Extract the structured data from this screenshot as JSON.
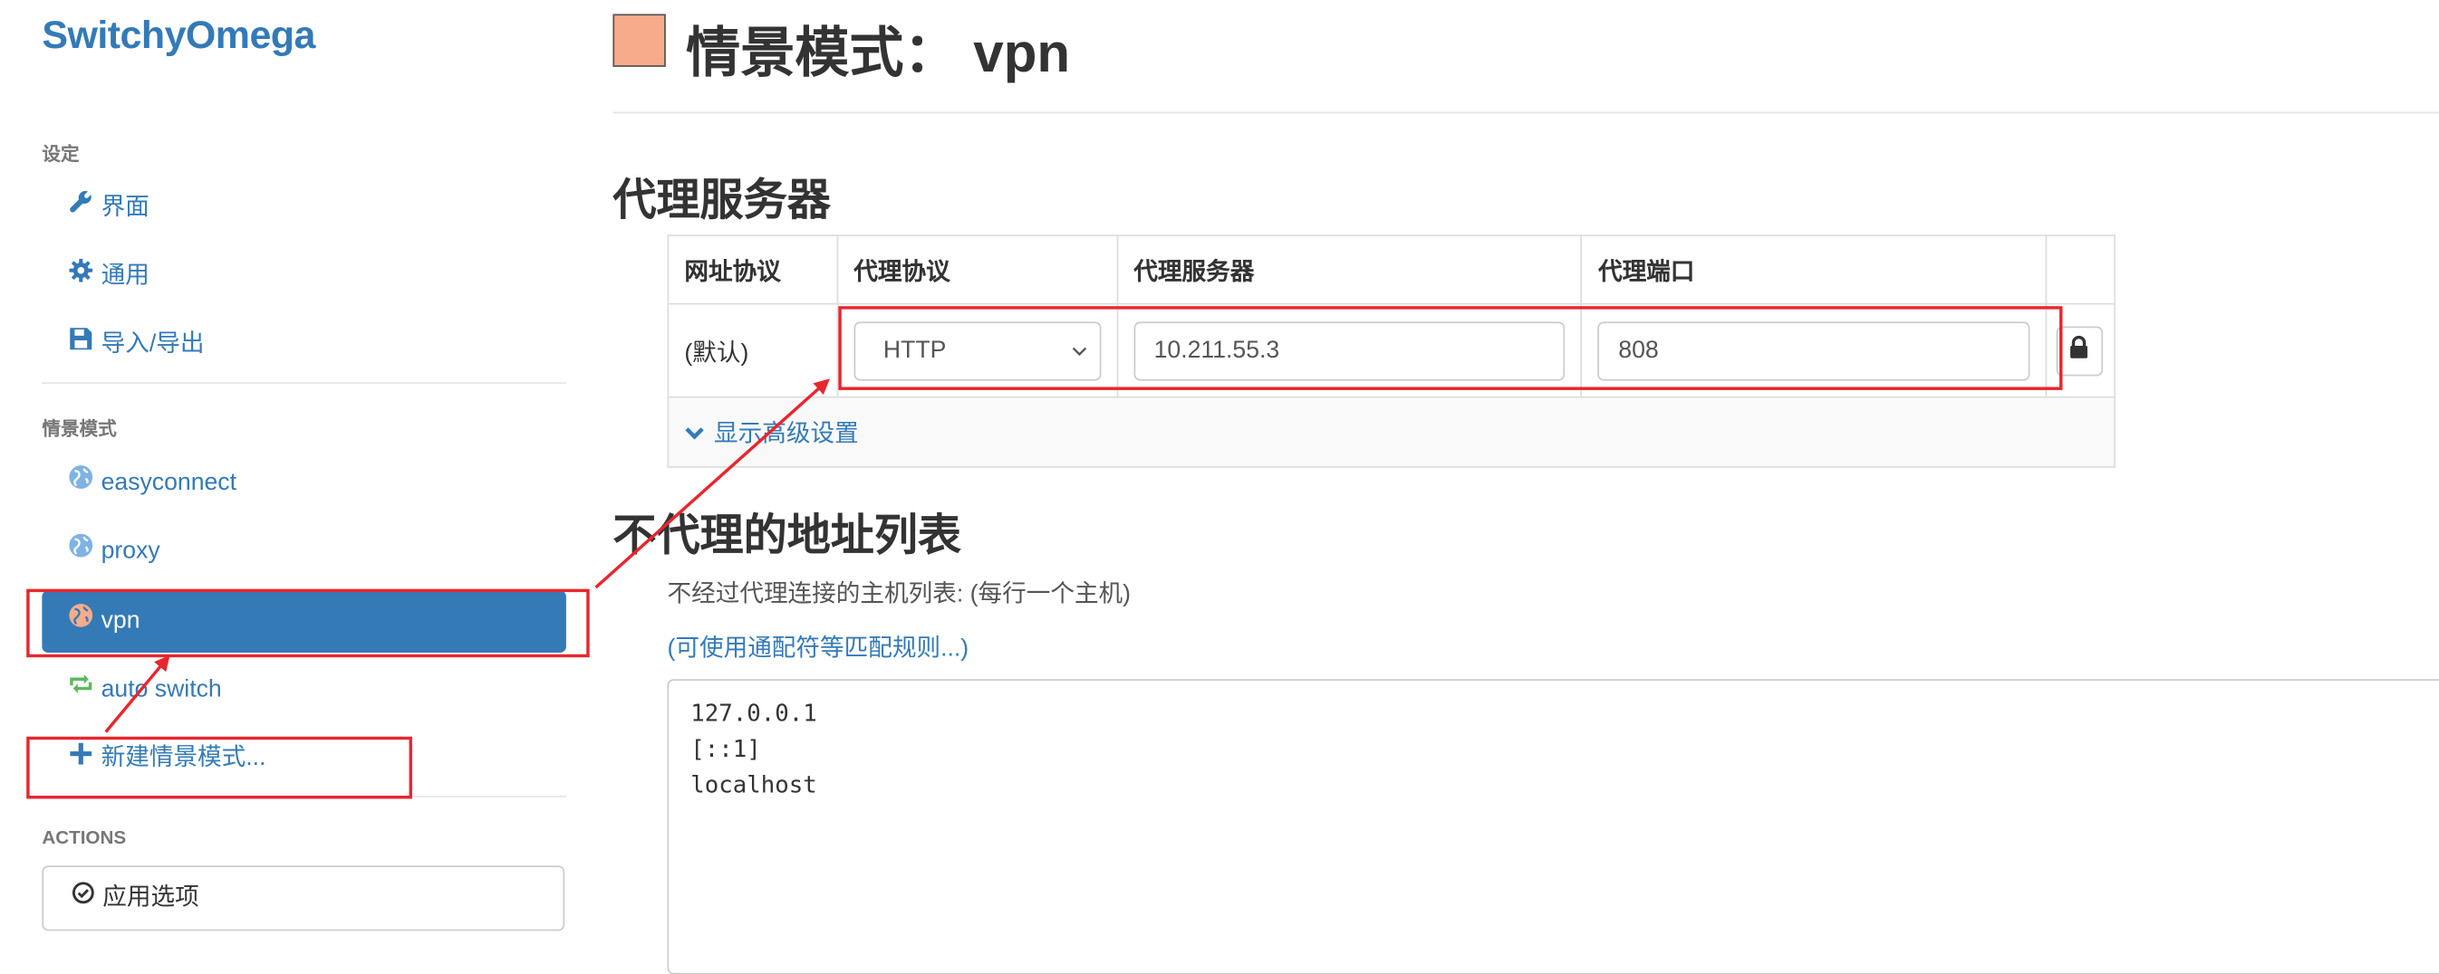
{
  "app": {
    "name": "SwitchyOmega"
  },
  "sidebar": {
    "settings_header": "设定",
    "settings_items": [
      {
        "label": "界面",
        "icon": "wrench-icon"
      },
      {
        "label": "通用",
        "icon": "gear-icon"
      },
      {
        "label": "导入/导出",
        "icon": "floppy-disk-icon"
      }
    ],
    "profiles_header": "情景模式",
    "profiles": [
      {
        "label": "easyconnect",
        "icon": "globe-icon",
        "color": "#5b9bd5"
      },
      {
        "label": "proxy",
        "icon": "globe-icon",
        "color": "#5b9bd5"
      },
      {
        "label": "vpn",
        "icon": "globe-icon",
        "color": "#f8ab8a",
        "active": true
      },
      {
        "label": "auto switch",
        "icon": "switch-icon",
        "color": "#5cb85c"
      }
    ],
    "new_profile": "新建情景模式...",
    "actions_header": "ACTIONS",
    "apply_label": "应用选项"
  },
  "main": {
    "title_prefix": "情景模式：",
    "profile_name": "vpn",
    "profile_color": "#f8ab8a",
    "proxy_section_title": "代理服务器",
    "table": {
      "headers": [
        "网址协议",
        "代理协议",
        "代理服务器",
        "代理端口"
      ],
      "row_label": "(默认)",
      "protocol": "HTTP",
      "server": "10.211.55.3",
      "port": "808",
      "advanced_label": "显示高级设置"
    },
    "bypass_section_title": "不代理的地址列表",
    "bypass_help": "不经过代理连接的主机列表: (每行一个主机)",
    "bypass_link": "(可使用通配符等匹配规则...)",
    "bypass_list": [
      "127.0.0.1",
      "[::1]",
      "localhost"
    ]
  },
  "colors": {
    "accent": "#337ab7",
    "annotation": "#e8262e"
  }
}
